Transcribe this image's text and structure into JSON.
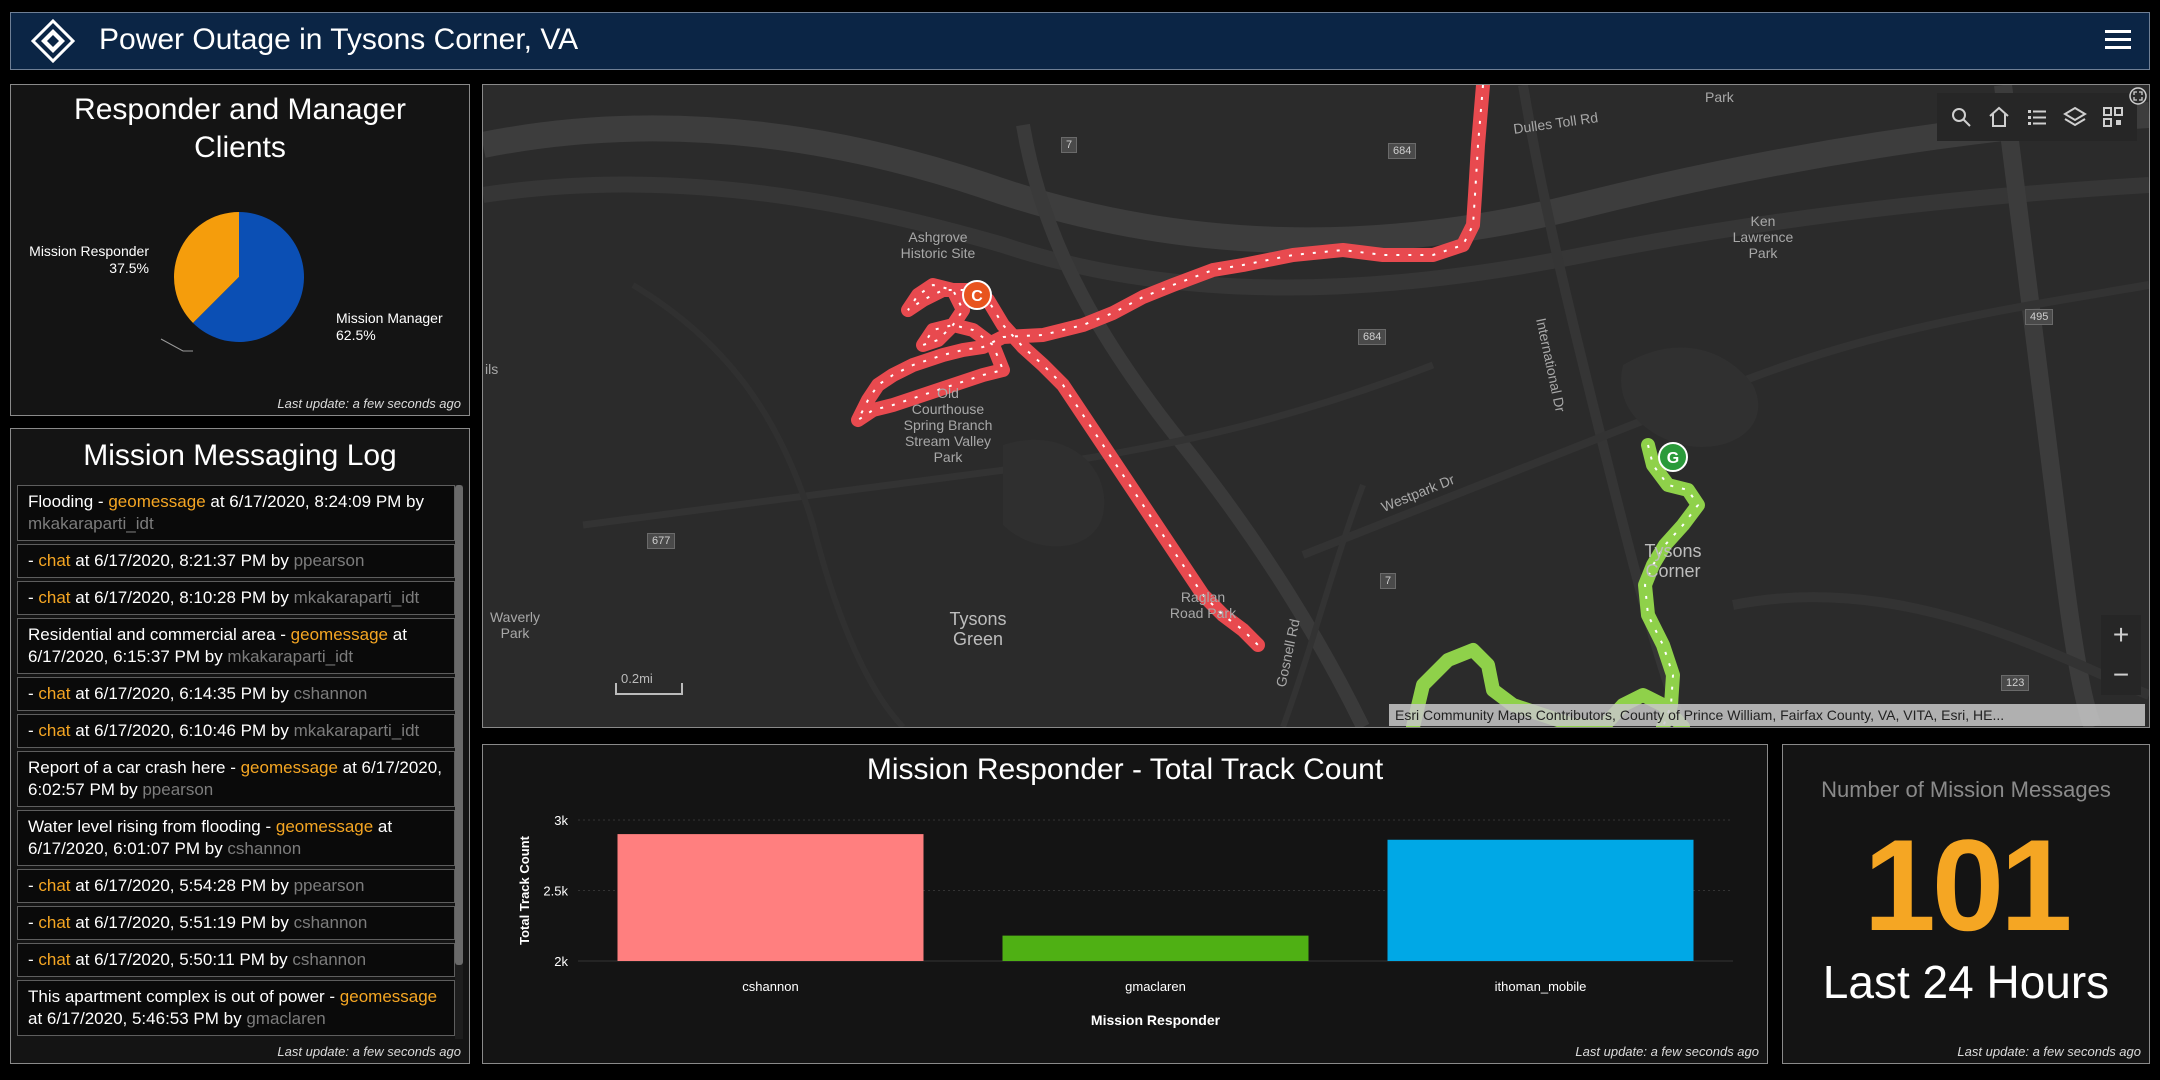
{
  "header": {
    "title": "Power Outage in Tysons Corner, VA",
    "logo_icon": "diamond-logo-icon",
    "menu_icon": "hamburger-menu-icon",
    "color": "#0b2545"
  },
  "pie_panel": {
    "title": "Responder and Manager Clients",
    "slices": [
      {
        "label": "Mission Responder 37.5%",
        "value": 37.5,
        "color": "#f59d0c"
      },
      {
        "label": "Mission Manager 62.5%",
        "value": 62.5,
        "color": "#0b4fb4"
      }
    ],
    "last_update": "Last update: a few seconds ago"
  },
  "log_panel": {
    "title": "Mission Messaging Log",
    "items": [
      {
        "pre": "Flooding - ",
        "type": "geomessage",
        "mid": " at 6/17/2020, 8:24:09 PM by ",
        "user": "mkakaraparti_idt"
      },
      {
        "pre": "- ",
        "type": "chat",
        "mid": " at 6/17/2020, 8:21:37 PM by ",
        "user": "ppearson"
      },
      {
        "pre": "- ",
        "type": "chat",
        "mid": " at 6/17/2020, 8:10:28 PM by ",
        "user": "mkakaraparti_idt"
      },
      {
        "pre": "Residential and commercial area - ",
        "type": "geomessage",
        "mid": " at 6/17/2020, 6:15:37 PM by ",
        "user": "mkakaraparti_idt"
      },
      {
        "pre": "- ",
        "type": "chat",
        "mid": " at 6/17/2020, 6:14:35 PM by ",
        "user": "cshannon"
      },
      {
        "pre": "- ",
        "type": "chat",
        "mid": " at 6/17/2020, 6:10:46 PM by ",
        "user": "mkakaraparti_idt"
      },
      {
        "pre": "Report of a car crash here - ",
        "type": "geomessage",
        "mid": " at 6/17/2020, 6:02:57 PM by ",
        "user": "ppearson"
      },
      {
        "pre": "Water level rising from flooding - ",
        "type": "geomessage",
        "mid": " at 6/17/2020, 6:01:07 PM by ",
        "user": "cshannon"
      },
      {
        "pre": "- ",
        "type": "chat",
        "mid": " at 6/17/2020, 5:54:28 PM by ",
        "user": "ppearson"
      },
      {
        "pre": "- ",
        "type": "chat",
        "mid": " at 6/17/2020, 5:51:19 PM by ",
        "user": "cshannon"
      },
      {
        "pre": "- ",
        "type": "chat",
        "mid": " at 6/17/2020, 5:50:11 PM by ",
        "user": "cshannon"
      },
      {
        "pre": "This apartment complex is out of power - ",
        "type": "geomessage",
        "mid": " at 6/17/2020, 5:46:53 PM by ",
        "user": "gmaclaren"
      }
    ],
    "last_update": "Last update: a few seconds ago"
  },
  "map": {
    "labels": {
      "park_top": "Park",
      "dulles": "Dulles Toll Rd",
      "ashgrove": "Ashgrove Historic Site",
      "ken_lawrence": "Ken Lawrence Park",
      "old_courthouse": "Old Courthouse Spring Branch Stream Valley Park",
      "international": "International Dr",
      "westpark": "Westpark Dr",
      "tysons_corner": "Tysons Corner",
      "raglan": "Raglan Road Park",
      "tysons_green": "Tysons Green",
      "waverly": "Waverly Park",
      "gosnell": "Gosnell Rd",
      "ils": "ils",
      "route_7a": "7",
      "route_7b": "7",
      "route_684a": "684",
      "route_684b": "684",
      "route_677": "677",
      "route_495": "495",
      "route_123": "123",
      "scale": "0.2mi"
    },
    "markers": {
      "c": {
        "label": "C",
        "color": "#e8541e"
      },
      "g": {
        "label": "G",
        "color": "#2a9a3a"
      }
    },
    "track_colors": {
      "red": "#e84a4f",
      "green": "#8fd14a"
    },
    "tools": [
      "search-icon",
      "home-icon",
      "list-icon",
      "layers-icon",
      "qr-icon"
    ],
    "zoom_in": "+",
    "zoom_out": "−",
    "attribution": "Esri Community Maps Contributors, County of Prince William, Fairfax County, VA, VITA, Esri, HE..."
  },
  "chart_data": {
    "type": "bar",
    "title": "Mission Responder - Total Track Count",
    "categories": [
      "cshannon",
      "gmaclaren",
      "ithoman_mobile"
    ],
    "values": [
      2900,
      2180,
      2860
    ],
    "colors": [
      "#ff7f7f",
      "#4fb014",
      "#00a8e6"
    ],
    "xlabel": "Mission Responder",
    "ylabel": "Total Track Count",
    "ylim": [
      2000,
      3000
    ],
    "yticks": [
      2000,
      2500,
      3000
    ],
    "ytick_labels": [
      "2k",
      "2.5k",
      "3k"
    ],
    "last_update": "Last update: a few seconds ago"
  },
  "kpi": {
    "label": "Number of Mission Messages",
    "value": "101",
    "subtitle": "Last 24 Hours",
    "color": "#f5a623",
    "last_update": "Last update: a few seconds ago"
  }
}
